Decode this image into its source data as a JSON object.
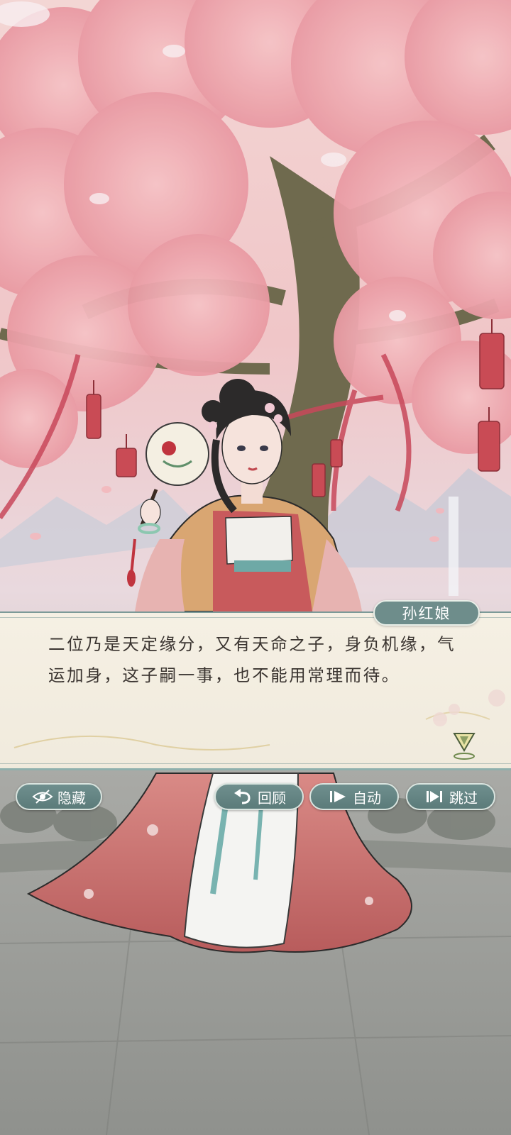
{
  "dialog": {
    "speaker": "孙红娘",
    "text": "二位乃是天定缘分，又有天命之子，身负机缘，气运加身，这子嗣一事，也不能用常理而待。"
  },
  "controls": {
    "hide_label": "隐藏",
    "review_label": "回顾",
    "auto_label": "自动",
    "skip_label": "跳过"
  },
  "icons": {
    "hide": "eye-slash-icon",
    "review": "undo-arrow-icon",
    "auto": "play-icon",
    "skip": "skip-forward-icon",
    "advance": "down-triangle-icon"
  },
  "colors": {
    "button_teal": "#6f8f8e",
    "dialog_bg": "#f4efe2",
    "text": "#3a3430",
    "blossom": "#eea6ad",
    "ribbon": "#c8485a"
  }
}
